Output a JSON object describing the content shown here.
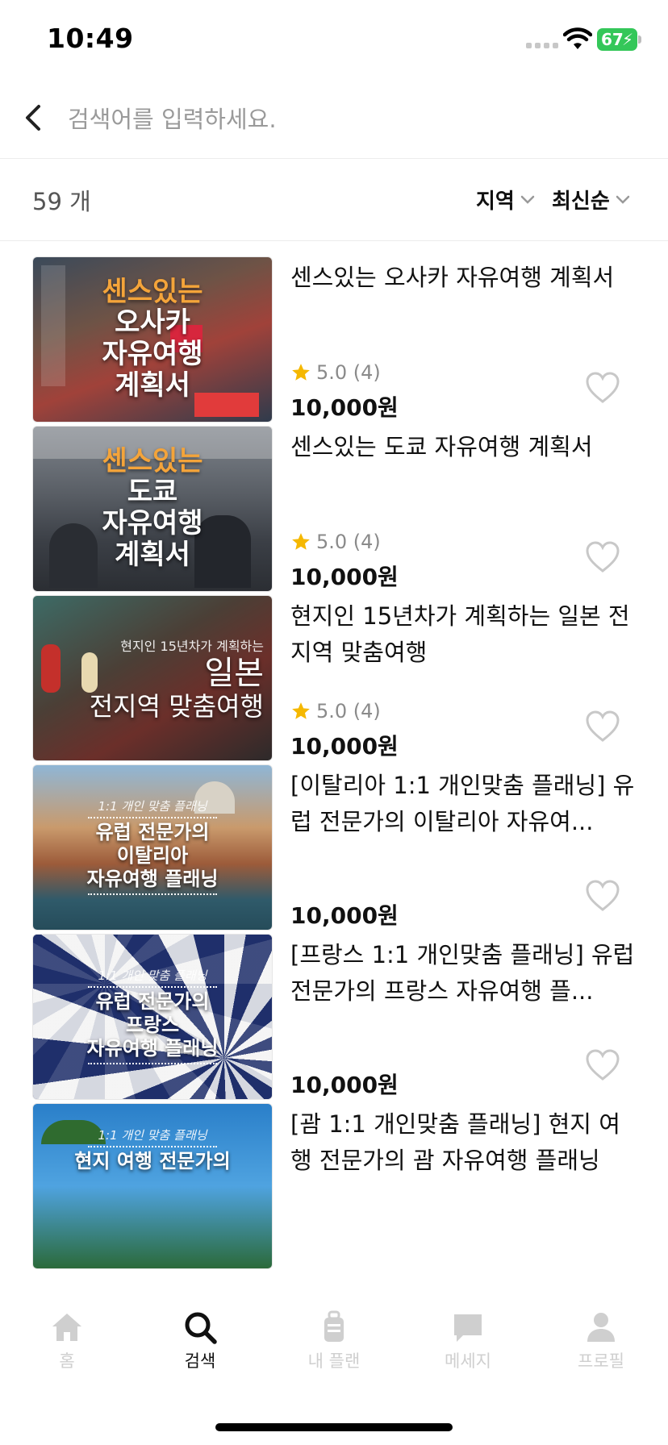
{
  "status_bar": {
    "time": "10:49",
    "battery": "67"
  },
  "search": {
    "placeholder": "검색어를 입력하세요.",
    "value": ""
  },
  "results": {
    "count_label": "59 개"
  },
  "filters": {
    "region_label": "지역",
    "sort_label": "최신순"
  },
  "colors": {
    "accent_star": "#f5b800",
    "active_tab": "#111111",
    "inactive_tab": "#cfcfcf",
    "battery": "#34c759"
  },
  "items": [
    {
      "title": "센스있는 오사카 자유여행 계획서",
      "rating": "5.0 (4)",
      "price": "10,000원",
      "thumb_lines": [
        "센스있는",
        "오사카",
        "자유여행",
        "계획서"
      ]
    },
    {
      "title": "센스있는 도쿄 자유여행 계획서",
      "rating": "5.0 (4)",
      "price": "10,000원",
      "thumb_lines": [
        "센스있는",
        "도쿄",
        "자유여행",
        "계획서"
      ]
    },
    {
      "title": "현지인 15년차가 계획하는 일본 전지역 맞춤여행",
      "rating": "5.0 (4)",
      "price": "10,000원",
      "thumb_lines": [
        "현지인 15년차가 계획하는",
        "일본",
        "전지역 맞춤여행"
      ]
    },
    {
      "title": "[이탈리아 1:1 개인맞춤 플래닝] 유럽 전문가의 이탈리아 자유여...",
      "price": "10,000원",
      "thumb_lines": [
        "1:1 개인 맞춤 플래닝",
        "유럽 전문가의",
        "이탈리아",
        "자유여행 플래닝"
      ]
    },
    {
      "title": "[프랑스 1:1 개인맞춤 플래닝] 유럽 전문가의 프랑스 자유여행 플...",
      "price": "10,000원",
      "thumb_lines": [
        "1:1 개인 맞춤 플래닝",
        "유럽 전문가의",
        "프랑스",
        "자유여행 플래닝"
      ]
    },
    {
      "title": "[괌 1:1 개인맞춤 플래닝] 현지 여행 전문가의 괌 자유여행 플래닝",
      "thumb_lines": [
        "1:1 개인 맞춤 플래닝",
        "현지 여행 전문가의"
      ]
    }
  ],
  "tabs": [
    {
      "label": "홈",
      "icon": "home-icon",
      "active": false
    },
    {
      "label": "검색",
      "icon": "search-icon",
      "active": true
    },
    {
      "label": "내 플랜",
      "icon": "luggage-icon",
      "active": false
    },
    {
      "label": "메세지",
      "icon": "chat-bubble-icon",
      "active": false
    },
    {
      "label": "프로필",
      "icon": "person-icon",
      "active": false
    }
  ]
}
